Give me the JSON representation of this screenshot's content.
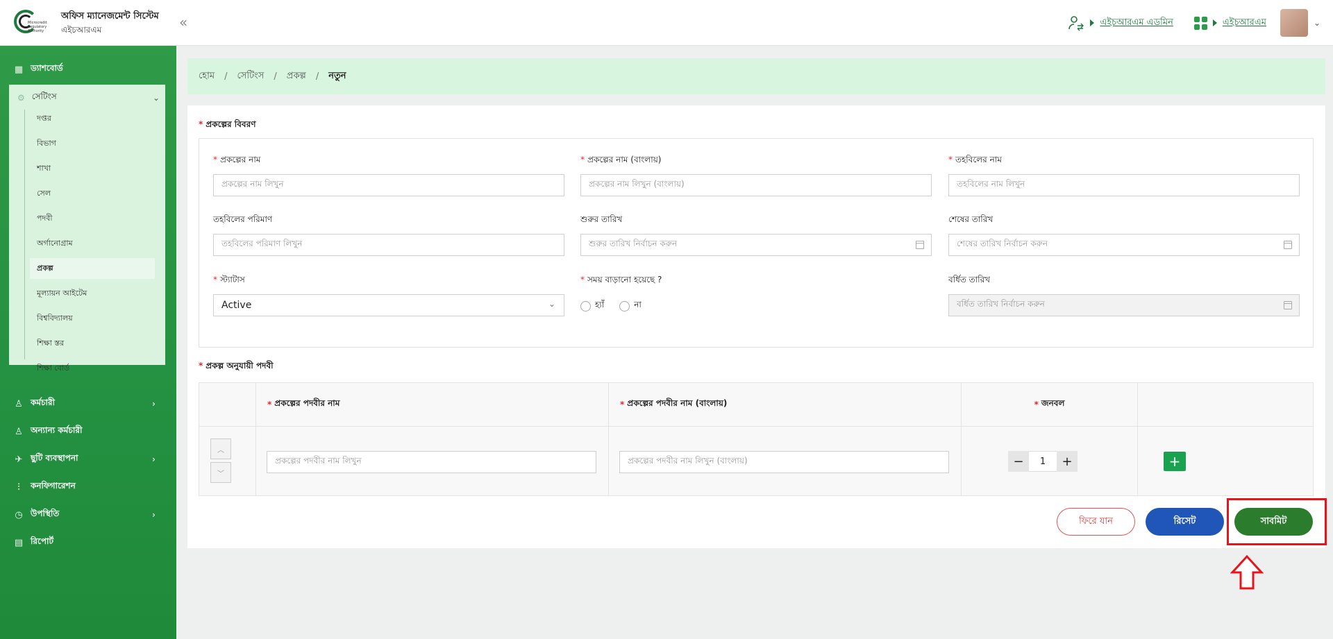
{
  "header": {
    "logo_text": "Microcredit Regulatory Authority",
    "app_title": "অফিস ম্যানেজমেন্ট সিস্টেম",
    "app_subtitle": "এইচআরএম",
    "collapse_glyph": "«",
    "role_link": "এইচআরএম এডমিন",
    "module_link": "এইচআরএম"
  },
  "sidebar": {
    "dashboard": "ড্যাশবোর্ড",
    "settings": "সেটিংস",
    "settings_items": [
      "দপ্তর",
      "বিভাগ",
      "শাখা",
      "সেল",
      "পদবী",
      "অর্গানোগ্রাম",
      "প্রকল্প",
      "মূল্যায়ন আইটেম",
      "বিশ্ববিদ্যালয়",
      "শিক্ষা স্তর",
      "শিক্ষা বোর্ড"
    ],
    "employee": "কর্মচারী",
    "other_employee": "অন্যান্য কর্মচারী",
    "leave_management": "ছুটি ব্যবস্থাপনা",
    "configuration": "কনফিগারেশন",
    "attendance": "উপস্থিতি",
    "report": "রিপোর্ট"
  },
  "breadcrumb": {
    "home": "হোম",
    "settings": "সেটিংস",
    "project": "প্রকল্প",
    "current": "নতুন",
    "separator": "/"
  },
  "form": {
    "section1_title": "প্রকল্পের বিবরণ",
    "project_name": {
      "label": "প্রকল্পের নাম",
      "placeholder": "প্রকল্পের নাম লিখুন"
    },
    "project_name_bn": {
      "label": "প্রকল্পের নাম (বাংলায়)",
      "placeholder": "প্রকল্পের নাম লিখুন (বাংলায়)"
    },
    "fund_name": {
      "label": "তহবিলের নাম",
      "placeholder": "তহবিলের নাম লিখুন"
    },
    "fund_amount": {
      "label": "তহবিলের পরিমাণ",
      "placeholder": "তহবিলের পরিমাণ লিখুন"
    },
    "start_date": {
      "label": "শুরুর তারিখ",
      "placeholder": "শুরুর তারিখ নির্বাচন করুন"
    },
    "end_date": {
      "label": "শেষের তারিখ",
      "placeholder": "শেষের তারিখ নির্বাচন করুন"
    },
    "status": {
      "label": "স্ট্যাটাস",
      "value": "Active"
    },
    "extended": {
      "label": "সময় বাড়ানো হয়েছে ?",
      "yes": "হ্যাঁ",
      "no": "না"
    },
    "extended_date": {
      "label": "বর্ধিত তারিখ",
      "placeholder": "বর্ধিত তারিখ নির্বাচন করুন"
    },
    "section2_title": "প্রকল্প অনুযায়ী পদবী",
    "table": {
      "col_designation": "প্রকল্পের পদবীর নাম",
      "col_designation_bn": "প্রকল্পের পদবীর নাম (বাংলায়)",
      "col_manpower": "জনবল",
      "designation_placeholder": "প্রকল্পের পদবীর নাম লিখুন",
      "designation_bn_placeholder": "প্রকল্পের পদবীর নাম লিখুন (বাংলায়)",
      "manpower_value": "1"
    },
    "buttons": {
      "back": "ফিরে যান",
      "reset": "রিসেট",
      "submit": "সাবমিট"
    }
  },
  "colors": {
    "primary_green": "#2b7d2d",
    "sidebar_green": "#2a9946",
    "highlight_red": "#e8141c"
  }
}
